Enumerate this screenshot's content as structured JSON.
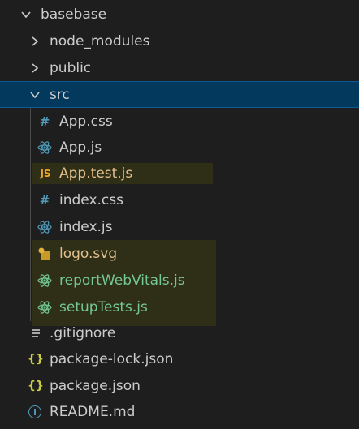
{
  "explorer": {
    "items": [
      {
        "label": "basebase",
        "type": "folder",
        "expanded": true,
        "icon": "chevron-down-icon"
      },
      {
        "label": "node_modules",
        "type": "folder",
        "expanded": false,
        "icon": "chevron-right-icon"
      },
      {
        "label": "public",
        "type": "folder",
        "expanded": false,
        "icon": "chevron-right-icon"
      },
      {
        "label": "src",
        "type": "folder",
        "expanded": true,
        "selected": true,
        "icon": "chevron-down-icon"
      },
      {
        "label": "App.css",
        "type": "file",
        "icon": "css-hash-icon",
        "icon_glyph": "#"
      },
      {
        "label": "App.js",
        "type": "file",
        "icon": "react-icon"
      },
      {
        "label": "App.test.js",
        "type": "file",
        "icon": "js-icon",
        "icon_glyph": "JS",
        "status": "modified"
      },
      {
        "label": "index.css",
        "type": "file",
        "icon": "css-hash-icon",
        "icon_glyph": "#"
      },
      {
        "label": "index.js",
        "type": "file",
        "icon": "react-icon"
      },
      {
        "label": "logo.svg",
        "type": "file",
        "icon": "svg-file-icon",
        "status": "modified"
      },
      {
        "label": "reportWebVitals.js",
        "type": "file",
        "icon": "react-icon",
        "status": "untracked"
      },
      {
        "label": "setupTests.js",
        "type": "file",
        "icon": "react-icon",
        "status": "untracked"
      },
      {
        "label": ".gitignore",
        "type": "file",
        "icon": "lines-icon"
      },
      {
        "label": "package-lock.json",
        "type": "file",
        "icon": "json-braces-icon",
        "icon_glyph": "{}"
      },
      {
        "label": "package.json",
        "type": "file",
        "icon": "json-braces-icon",
        "icon_glyph": "{}"
      },
      {
        "label": "README.md",
        "type": "file",
        "icon": "info-icon",
        "icon_glyph": "i"
      }
    ]
  },
  "colors": {
    "background": "#1e1e1e",
    "selection": "#04395e",
    "modified_text": "#e2c08d",
    "untracked_text": "#73c991",
    "css_icon": "#519aba",
    "react_icon": "#519aba",
    "js_icon": "#f5a623",
    "json_icon": "#cbcb41"
  }
}
